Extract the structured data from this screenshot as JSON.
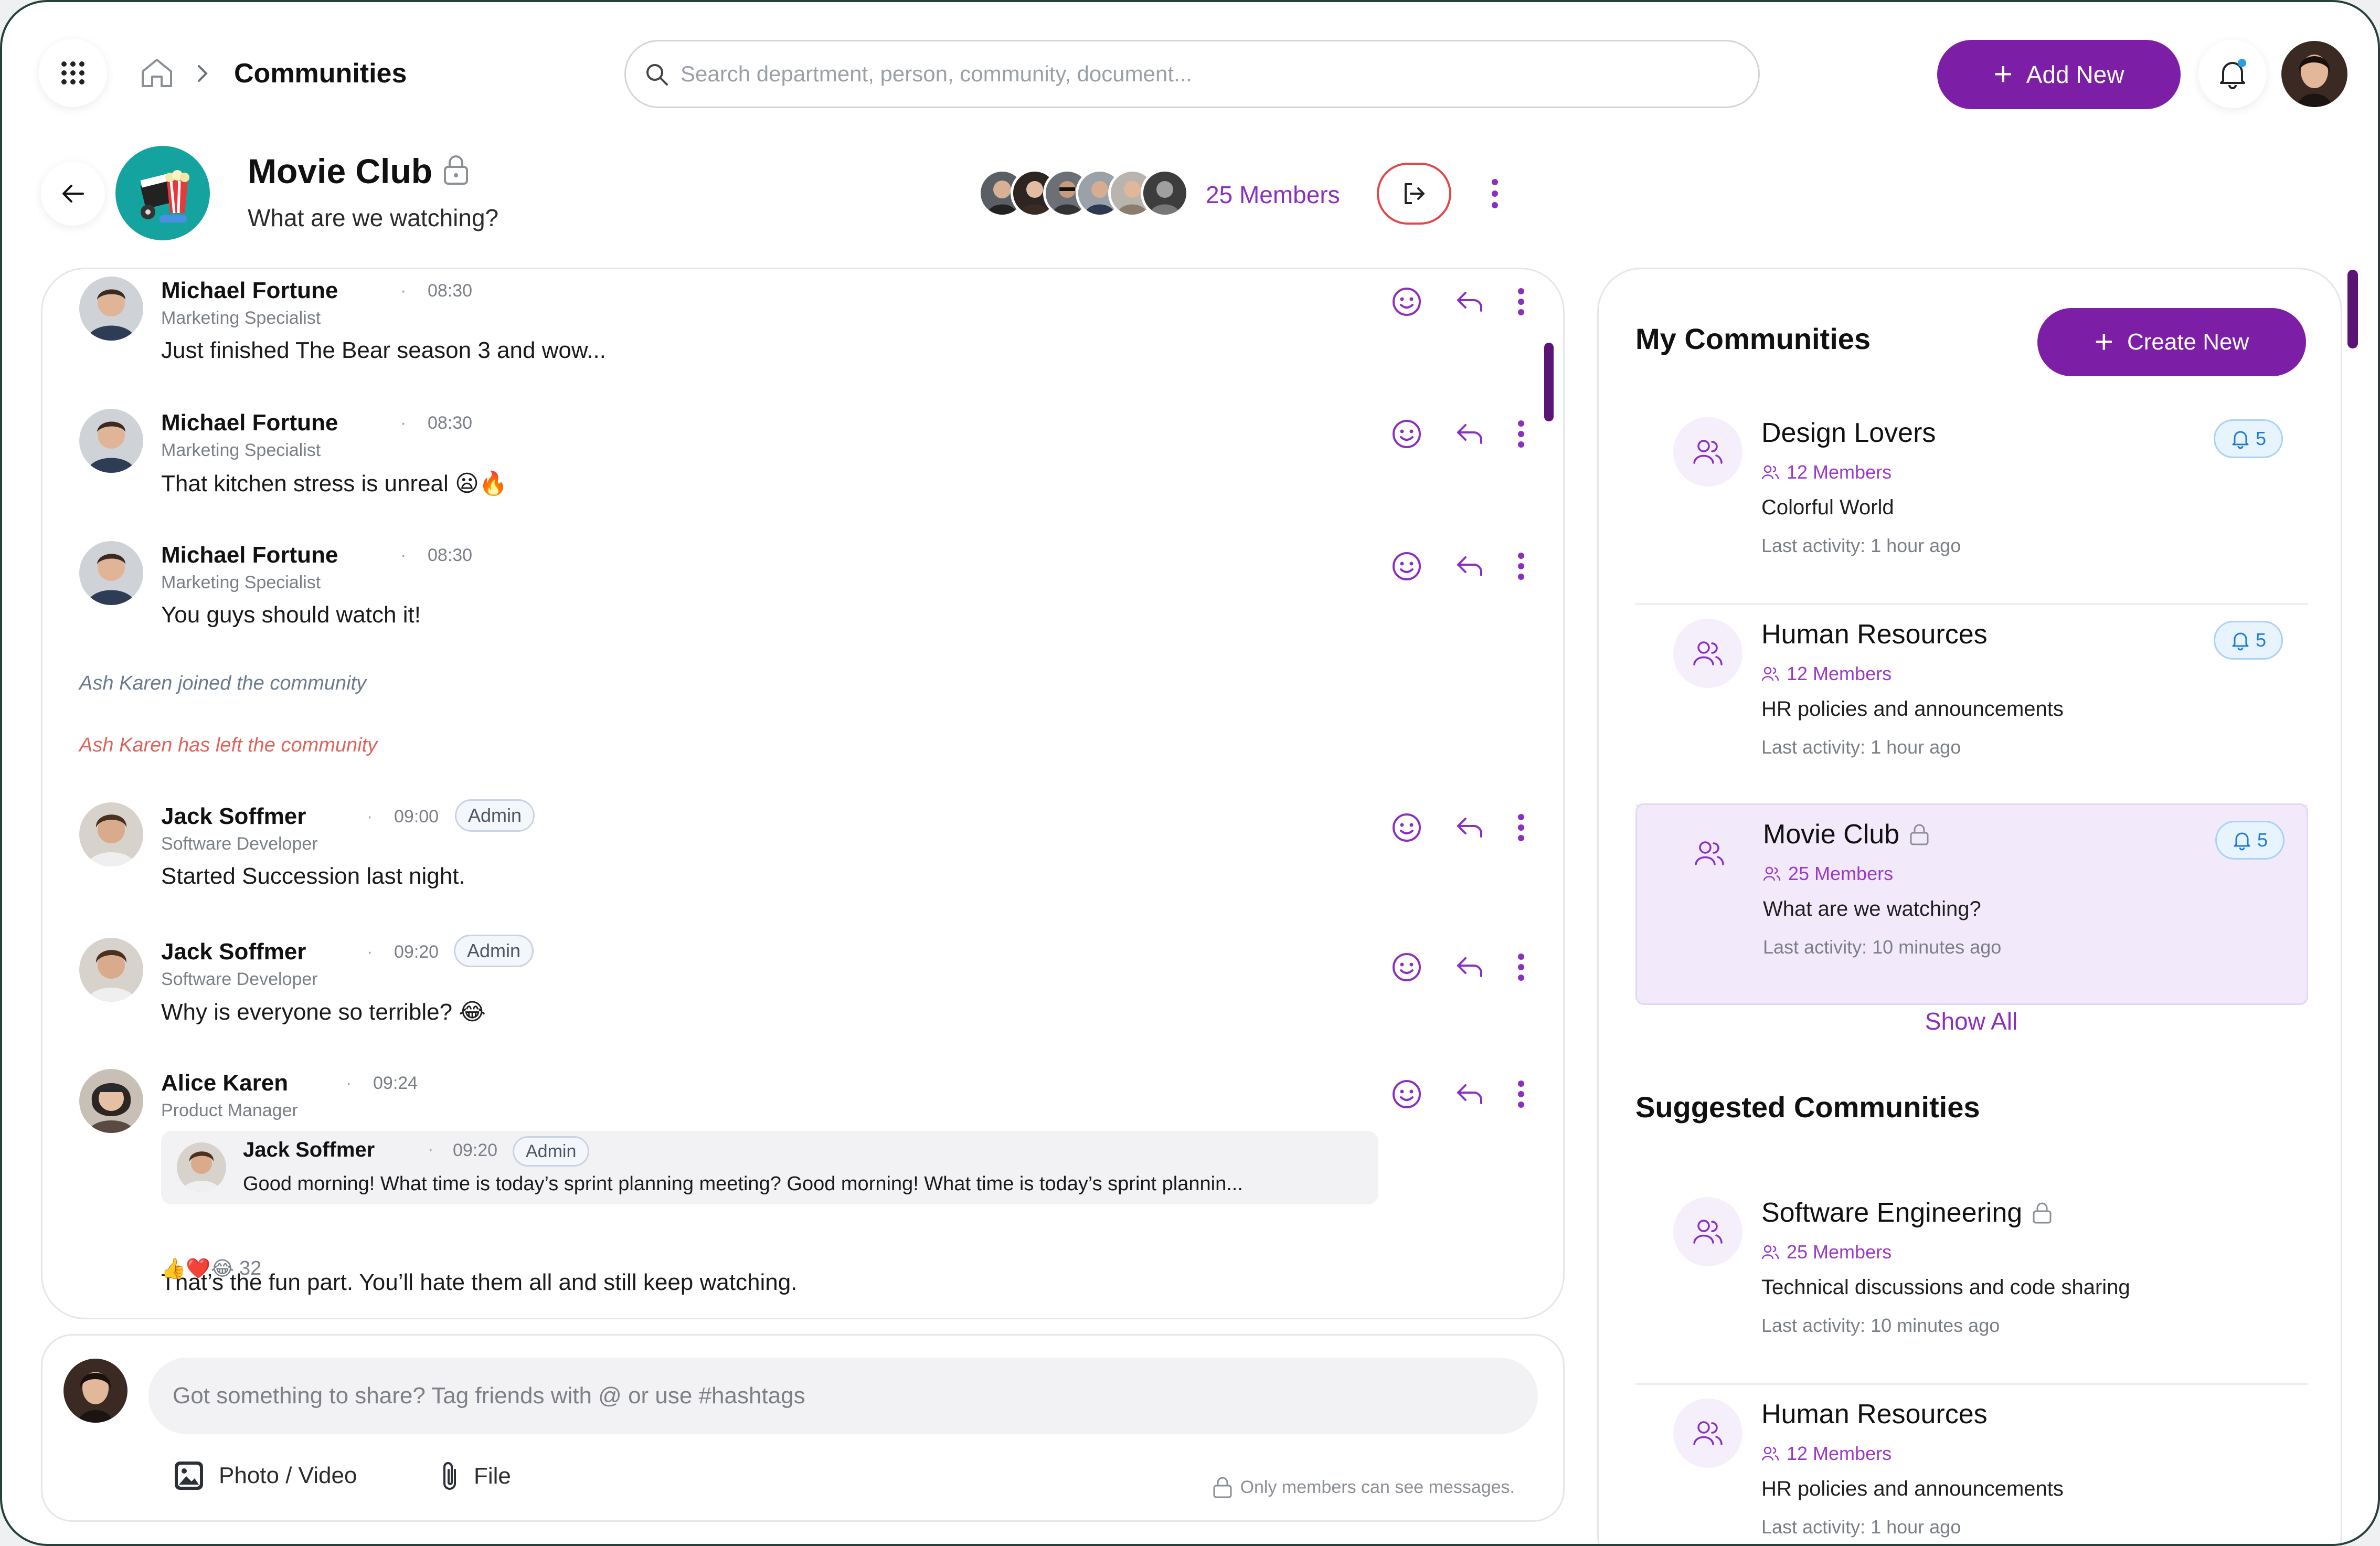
{
  "topbar": {
    "breadcrumb": "Communities",
    "search_placeholder": "Search department, person, community, document...",
    "add_new_label": "Add New"
  },
  "community": {
    "title": "Movie Club",
    "subtitle": "What are we watching?",
    "members_label": "25 Members"
  },
  "messages": [
    {
      "name": "Michael Fortune",
      "time": "08:30",
      "role": "Marketing Specialist",
      "text": "Just finished The Bear season 3 and wow..."
    },
    {
      "name": "Michael Fortune",
      "time": "08:30",
      "role": "Marketing Specialist",
      "text": "That kitchen stress is unreal 😦🔥"
    },
    {
      "name": "Michael Fortune",
      "time": "08:30",
      "role": "Marketing Specialist",
      "text": "You guys should watch it!"
    },
    {
      "name": "Jack Soffmer",
      "time": "09:00",
      "role": "Software Developer",
      "badge": "Admin",
      "text": "Started Succession last night."
    },
    {
      "name": "Jack Soffmer",
      "time": "09:20",
      "role": "Software Developer",
      "badge": "Admin",
      "text": "Why is everyone so terrible? 😂"
    },
    {
      "name": "Alice Karen",
      "time": "09:24",
      "role": "Product Manager",
      "text": "That’s the fun part. You’ll hate them all and still keep watching."
    }
  ],
  "system": {
    "joined": "Ash Karen joined the community",
    "left": "Ash Karen has left the community"
  },
  "quote": {
    "name": "Jack Soffmer",
    "time": "09:20",
    "badge": "Admin",
    "text": "Good morning! What time is today’s sprint planning meeting? Good morning! What time is today’s sprint plannin..."
  },
  "reactions": {
    "emojis": "👍❤️😂",
    "count": "32"
  },
  "composer": {
    "placeholder": "Got something to share? Tag friends with @ or use #hashtags",
    "photo_label": "Photo / Video",
    "file_label": "File",
    "privacy_note": "Only members can see messages."
  },
  "my_communities": {
    "title": "My Communities",
    "create_label": "Create New",
    "show_all": "Show All",
    "items": [
      {
        "name": "Design Lovers",
        "members": "12 Members",
        "desc": "Colorful World",
        "activity": "Last activity: 1 hour ago",
        "notifications": "5"
      },
      {
        "name": "Human Resources",
        "members": "12 Members",
        "desc": "HR policies and announcements",
        "activity": "Last activity: 1 hour ago",
        "notifications": "5"
      },
      {
        "name": "Movie Club",
        "members": "25 Members",
        "desc": "What are we watching?",
        "activity": "Last activity: 10 minutes ago",
        "notifications": "5"
      }
    ]
  },
  "suggested": {
    "title": "Suggested Communities",
    "items": [
      {
        "name": "Software Engineering",
        "members": "25 Members",
        "desc": "Technical discussions and code sharing",
        "activity": "Last activity: 10 minutes ago"
      },
      {
        "name": "Human Resources",
        "members": "12 Members",
        "desc": "HR policies and announcements",
        "activity": "Last activity: 1 hour ago"
      }
    ]
  },
  "colors": {
    "accent": "#7d1fa6",
    "leave": "#e14848",
    "link": "#8a2fc0"
  }
}
